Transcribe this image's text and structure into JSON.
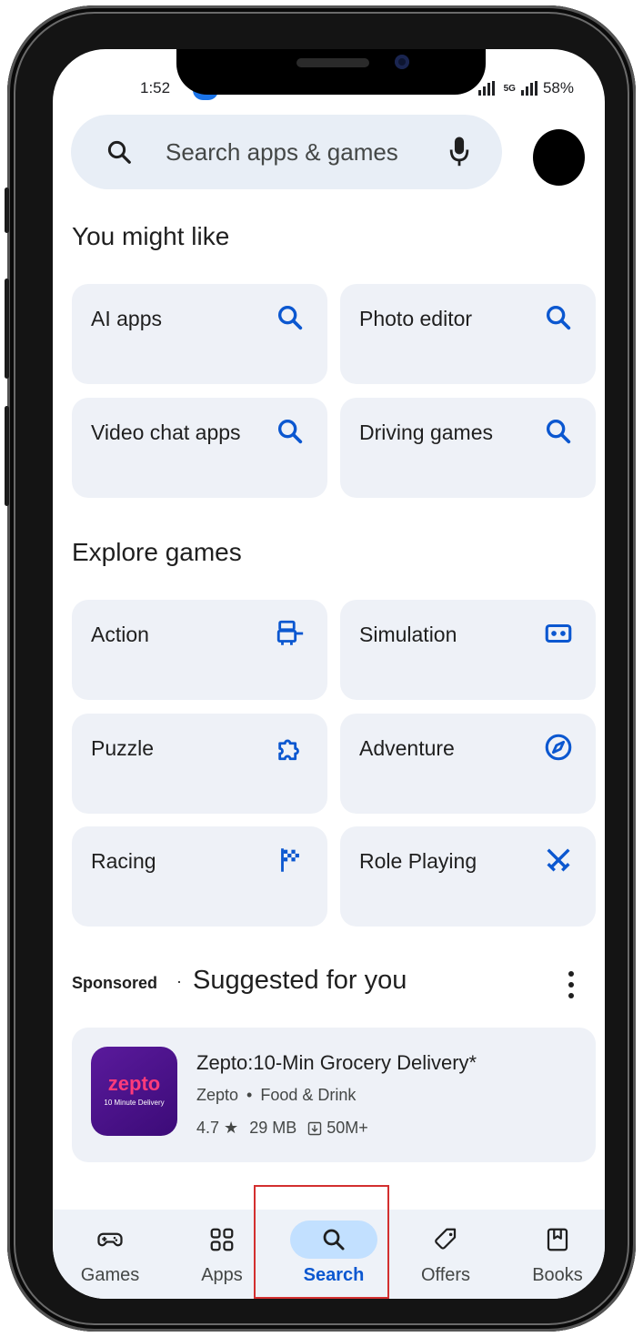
{
  "status_bar": {
    "time": "1:52",
    "network": "5G",
    "battery": "58%"
  },
  "search": {
    "placeholder": "Search apps & games"
  },
  "you_might_like": {
    "title": "You might like",
    "chips": [
      {
        "label": "AI apps",
        "icon": "search-icon"
      },
      {
        "label": "Photo editor",
        "icon": "search-icon"
      },
      {
        "label": "Video chat apps",
        "icon": "search-icon"
      },
      {
        "label": "Driving games",
        "icon": "search-icon"
      }
    ]
  },
  "explore_games": {
    "title": "Explore games",
    "chips": [
      {
        "label": "Action",
        "icon": "action-icon"
      },
      {
        "label": "Simulation",
        "icon": "vr-headset-icon"
      },
      {
        "label": "Puzzle",
        "icon": "puzzle-icon"
      },
      {
        "label": "Adventure",
        "icon": "compass-icon"
      },
      {
        "label": "Racing",
        "icon": "flag-icon"
      },
      {
        "label": "Role Playing",
        "icon": "swords-icon"
      }
    ]
  },
  "suggested": {
    "sponsored_label": "Sponsored",
    "separator": "·",
    "title": "Suggested for you",
    "app": {
      "icon_brand": "zepto",
      "icon_tagline": "10 Minute Delivery",
      "name": "Zepto:10-Min Grocery Delivery*",
      "developer": "Zepto",
      "category": "Food & Drink",
      "meta_separator": "•",
      "rating": "4.7",
      "rating_star": "★",
      "size": "29 MB",
      "downloads": "50M+"
    }
  },
  "bottom_nav": [
    {
      "label": "Games",
      "icon": "gamepad-icon",
      "active": false
    },
    {
      "label": "Apps",
      "icon": "apps-grid-icon",
      "active": false
    },
    {
      "label": "Search",
      "icon": "search-icon",
      "active": true
    },
    {
      "label": "Offers",
      "icon": "tag-icon",
      "active": false
    },
    {
      "label": "Books",
      "icon": "book-icon",
      "active": false
    }
  ],
  "colors": {
    "accent": "#0b57d0",
    "chip_bg": "#eef1f7",
    "active_pill": "#c2e0ff",
    "highlight": "#d32f2f"
  }
}
